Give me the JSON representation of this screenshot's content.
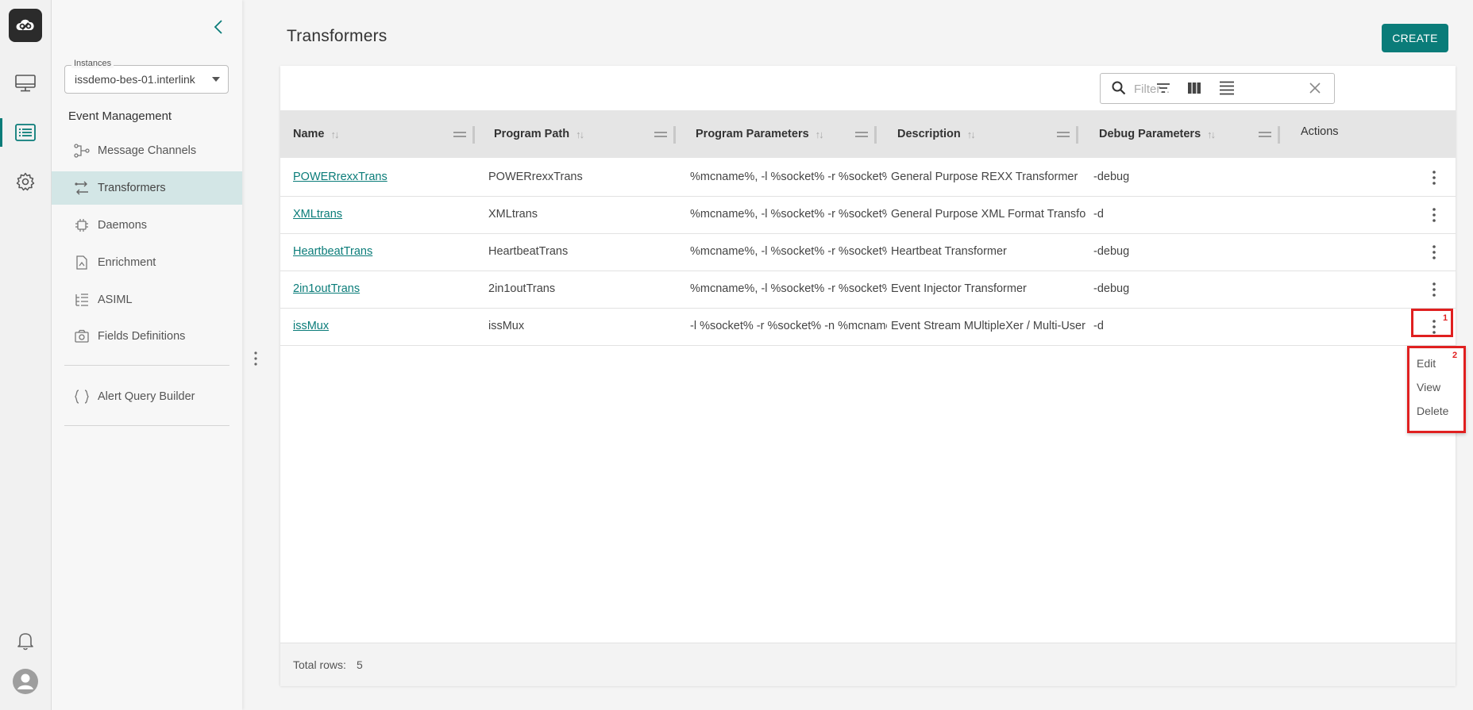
{
  "rail": {
    "logo": "cloud-link-logo",
    "items": [
      {
        "icon": "monitor-icon"
      },
      {
        "icon": "list-icon",
        "active": true
      },
      {
        "icon": "gear-icon"
      }
    ],
    "bottom": [
      {
        "icon": "bell-icon"
      },
      {
        "icon": "user-avatar-icon"
      }
    ]
  },
  "sidebar": {
    "instance_label": "Instances",
    "instance_value": "issdemo-bes-01.interlink",
    "section_title": "Event Management",
    "items": [
      {
        "label": "Message Channels",
        "icon": "channels-icon"
      },
      {
        "label": "Transformers",
        "icon": "transformers-icon",
        "active": true
      },
      {
        "label": "Daemons",
        "icon": "chip-icon"
      },
      {
        "label": "Enrichment",
        "icon": "document-icon"
      },
      {
        "label": "ASIML",
        "icon": "tree-list-icon"
      },
      {
        "label": "Fields Definitions",
        "icon": "camera-icon"
      }
    ],
    "extra_items": [
      {
        "label": "Alert Query Builder",
        "icon": "braces-icon"
      }
    ]
  },
  "header": {
    "title": "Transformers",
    "create_label": "CREATE"
  },
  "toolbar": {
    "filter_placeholder": "Filter..."
  },
  "table": {
    "columns": [
      "Name",
      "Program Path",
      "Program Parameters",
      "Description",
      "Debug Parameters",
      "Actions"
    ],
    "rows": [
      {
        "name": "POWERrexxTrans",
        "path": "POWERrexxTrans",
        "params": "%mcname%, -l %socket% -r %socket%",
        "desc": "General Purpose REXX Transformer",
        "debug": "-debug"
      },
      {
        "name": "XMLtrans",
        "path": "XMLtrans",
        "params": "%mcname%, -l %socket% -r %socket%",
        "desc": "General Purpose XML Format Transformer",
        "debug": "-d"
      },
      {
        "name": "HeartbeatTrans",
        "path": "HeartbeatTrans",
        "params": "%mcname%, -l %socket% -r %socket%",
        "desc": "Heartbeat Transformer",
        "debug": "-debug"
      },
      {
        "name": "2in1outTrans",
        "path": "2in1outTrans",
        "params": "%mcname%, -l %socket% -r %socket%",
        "desc": "Event Injector Transformer",
        "debug": "-debug"
      },
      {
        "name": "issMux",
        "path": "issMux",
        "params": "-l %socket% -r %socket% -n %mcname%",
        "desc": "Event Stream MUltipleXer / Multi-User",
        "debug": "-d"
      }
    ],
    "footer_label": "Total rows:",
    "footer_count": "5"
  },
  "action_menu": {
    "items": [
      "Edit",
      "View",
      "Delete"
    ],
    "marker_1": "1",
    "marker_2": "2"
  },
  "colors": {
    "accent": "#0a7c79",
    "active_nav_bg": "#d3e6e6",
    "highlight": "#e02020"
  }
}
